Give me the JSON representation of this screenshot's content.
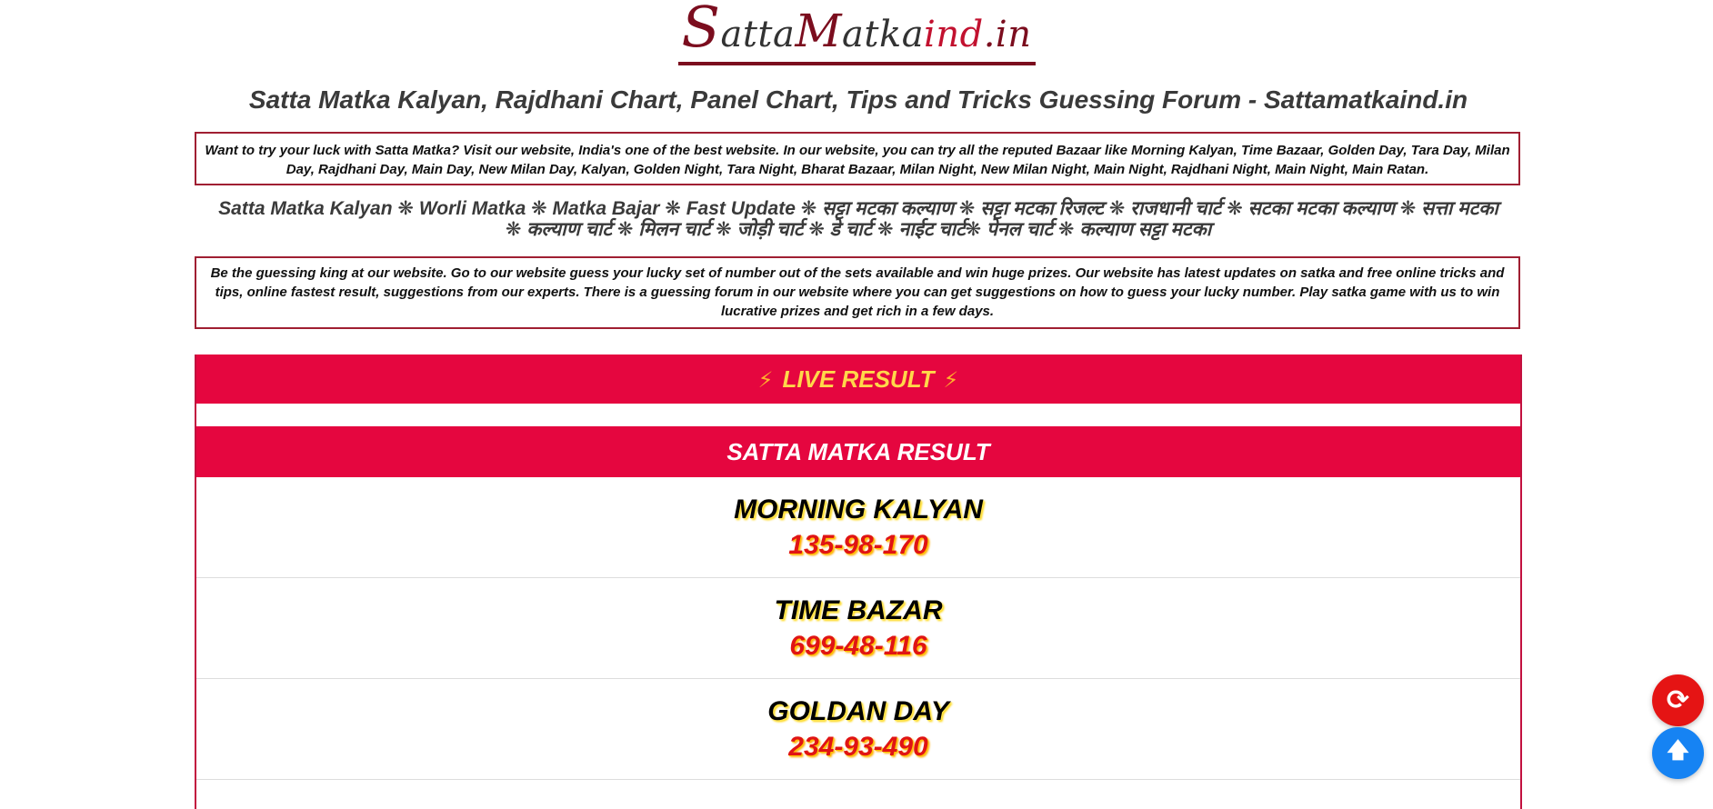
{
  "logo": {
    "part1": "S",
    "part2": "atta",
    "part3": "M",
    "part4": "atka",
    "part5": "ind",
    "part6": ".in"
  },
  "page_title": "Satta Matka Kalyan, Rajdhani Chart, Panel Chart, Tips and Tricks Guessing Forum - Sattamatkaind.in",
  "intro_text": "Want to try your luck with Satta Matka? Visit our website, India's one of the best website. In our website, you can try all the reputed Bazaar like Morning Kalyan, Time Bazaar, Golden Day, Tara Day, Milan Day, Rajdhani Day, Main Day, New Milan Day, Kalyan, Golden Night, Tara Night, Bharat Bazaar, Milan Night, New Milan Night, Main Night, Rajdhani Night, Main Night, Main Ratan.",
  "keywords_line": "Satta Matka Kalyan ❋ Worli Matka ❋ Matka Bajar ❋ Fast Update ❋ सट्टा मटका कल्याण ❋ सट्टा मटका रिजल्ट ❋ राजधानी चार्ट ❋ सटका मटका कल्याण ❋ सत्ता मटका ❋ कल्याण चार्ट ❋ मिलन चार्ट ❋ जोड़ी चार्ट ❋ डे चार्ट ❋ नाईट चार्ट❋ पेनल चार्ट ❋ कल्याण सट्टा मटका",
  "guess_text": "Be the guessing king at our website. Go to our website guess your lucky set of number out of the sets available and win huge prizes. Our website has latest updates on satka and free online tricks and tips, online fastest result, suggestions from our experts. There is a guessing forum in our website where you can get suggestions on how to guess your lucky number. Play satka game with us to win lucrative prizes and get rich in a few days.",
  "live_result": {
    "label": "LIVE RESULT",
    "bolt_icon": "⚡"
  },
  "result_header": "SATTA MATKA RESULT",
  "markets": [
    {
      "name": "MORNING KALYAN",
      "result": "135-98-170"
    },
    {
      "name": "TIME BAZAR",
      "result": "699-48-116"
    },
    {
      "name": "GOLDAN DAY",
      "result": "234-93-490"
    }
  ],
  "buttons": {
    "refresh_icon": "⟳",
    "scroll_top_icon": "🡅"
  },
  "colors": {
    "brand": "#7b0d1e",
    "accent": "#e5063f",
    "live_text": "#ffd84a",
    "result_red": "#e01414",
    "refresh_bg": "#e51414",
    "top_bg": "#1683f3"
  }
}
